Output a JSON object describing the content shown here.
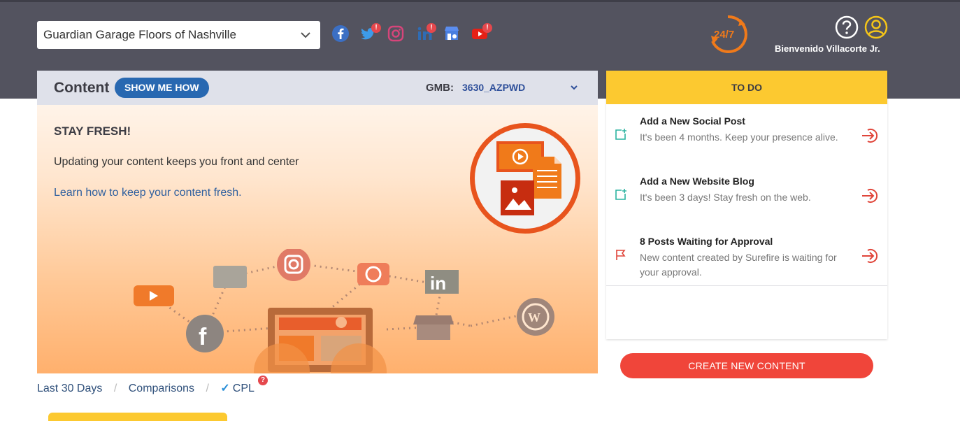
{
  "header": {
    "business_select_value": "Guardian Garage Floors of Nashville",
    "welcome_text": "Bienvenido Villacorte Jr.",
    "support_label": "24/7",
    "social_icons": [
      "facebook-icon",
      "twitter-icon",
      "instagram-icon",
      "linkedin-icon",
      "google-my-business-icon",
      "youtube-icon"
    ],
    "alert_badge": "!"
  },
  "content_card": {
    "title": "Content",
    "show_me_how": "SHOW ME HOW",
    "gmb_label": "GMB:",
    "gmb_value": "3630_AZPWD",
    "fresh_title": "STAY FRESH!",
    "fresh_text": "Updating your content keeps you front and center",
    "fresh_link": "Learn how to keep your content fresh."
  },
  "todo": {
    "header": "TO DO",
    "items": [
      {
        "title": "Add a New Social Post",
        "desc": "It's been 4 months. Keep your presence alive.",
        "icon": "add-post-icon"
      },
      {
        "title": "Add a New Website Blog",
        "desc": "It's been 3 days! Stay fresh on the web.",
        "icon": "add-post-icon"
      },
      {
        "title": "8 Posts Waiting for Approval",
        "desc": "New content created by Surefire is waiting for your approval.",
        "icon": "flag-icon"
      }
    ]
  },
  "create_button": "CREATE NEW CONTENT",
  "bottom_tabs": {
    "last30": "Last 30 Days",
    "separator": "/",
    "comparisons": "Comparisons",
    "cpl": "CPL",
    "cpl_badge": "?"
  },
  "colors": {
    "topbar": "#53535f",
    "accent_yellow": "#fcc930",
    "button_blue": "#2868b1",
    "create_red": "#f0453a",
    "link_blue": "#2e5f9e"
  }
}
